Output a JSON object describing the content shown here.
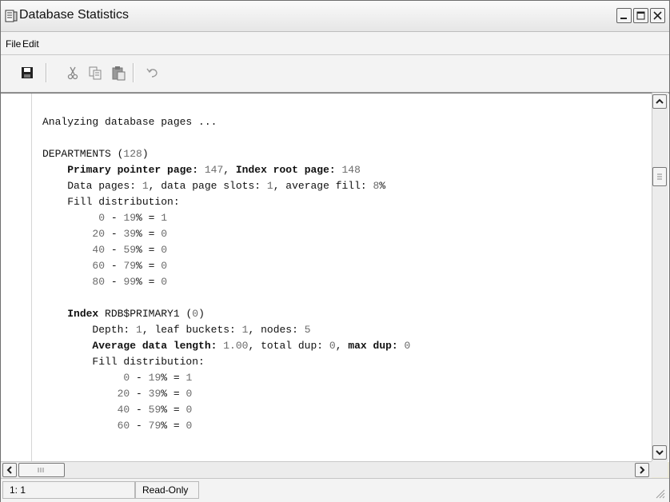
{
  "window": {
    "title": "Database Statistics",
    "app_icon": "database-statistics-icon"
  },
  "menu": [
    "File",
    "Edit"
  ],
  "toolbar": {
    "buttons": [
      "save-icon",
      "cut-icon",
      "copy-icon",
      "paste-icon",
      "undo-icon"
    ]
  },
  "editor": {
    "lines": [
      {
        "segments": [
          {
            "text": "Analyzing database pages ..."
          }
        ]
      },
      {
        "segments": []
      },
      {
        "segments": [
          {
            "text": "DEPARTMENTS ("
          },
          {
            "text": "128",
            "num": true
          },
          {
            "text": ")"
          }
        ]
      },
      {
        "segments": [
          {
            "text": "    "
          },
          {
            "text": "Primary pointer page: ",
            "bold": true
          },
          {
            "text": "147",
            "num": true
          },
          {
            "text": ", "
          },
          {
            "text": "Index root page: ",
            "bold": true
          },
          {
            "text": "148",
            "num": true
          }
        ]
      },
      {
        "segments": [
          {
            "text": "    Data pages: "
          },
          {
            "text": "1",
            "num": true
          },
          {
            "text": ", data page slots: "
          },
          {
            "text": "1",
            "num": true
          },
          {
            "text": ", average fill: "
          },
          {
            "text": "8",
            "num": true
          },
          {
            "text": "%"
          }
        ]
      },
      {
        "segments": [
          {
            "text": "    Fill distribution:"
          }
        ]
      },
      {
        "segments": [
          {
            "text": "         "
          },
          {
            "text": "0",
            "num": true
          },
          {
            "text": " - "
          },
          {
            "text": "19",
            "num": true
          },
          {
            "text": "% = "
          },
          {
            "text": "1",
            "num": true
          }
        ]
      },
      {
        "segments": [
          {
            "text": "        "
          },
          {
            "text": "20",
            "num": true
          },
          {
            "text": " - "
          },
          {
            "text": "39",
            "num": true
          },
          {
            "text": "% = "
          },
          {
            "text": "0",
            "num": true
          }
        ]
      },
      {
        "segments": [
          {
            "text": "        "
          },
          {
            "text": "40",
            "num": true
          },
          {
            "text": " - "
          },
          {
            "text": "59",
            "num": true
          },
          {
            "text": "% = "
          },
          {
            "text": "0",
            "num": true
          }
        ]
      },
      {
        "segments": [
          {
            "text": "        "
          },
          {
            "text": "60",
            "num": true
          },
          {
            "text": " - "
          },
          {
            "text": "79",
            "num": true
          },
          {
            "text": "% = "
          },
          {
            "text": "0",
            "num": true
          }
        ]
      },
      {
        "segments": [
          {
            "text": "        "
          },
          {
            "text": "80",
            "num": true
          },
          {
            "text": " - "
          },
          {
            "text": "99",
            "num": true
          },
          {
            "text": "% = "
          },
          {
            "text": "0",
            "num": true
          }
        ]
      },
      {
        "segments": []
      },
      {
        "segments": [
          {
            "text": "    "
          },
          {
            "text": "Index ",
            "bold": true
          },
          {
            "text": "RDB$PRIMARY1 ("
          },
          {
            "text": "0",
            "num": true
          },
          {
            "text": ")"
          }
        ]
      },
      {
        "segments": [
          {
            "text": "        Depth: "
          },
          {
            "text": "1",
            "num": true
          },
          {
            "text": ", leaf buckets: "
          },
          {
            "text": "1",
            "num": true
          },
          {
            "text": ", nodes: "
          },
          {
            "text": "5",
            "num": true
          }
        ]
      },
      {
        "segments": [
          {
            "text": "        "
          },
          {
            "text": "Average data length: ",
            "bold": true
          },
          {
            "text": "1.00",
            "num": true
          },
          {
            "text": ", total dup: "
          },
          {
            "text": "0",
            "num": true
          },
          {
            "text": ", "
          },
          {
            "text": "max dup: ",
            "bold": true
          },
          {
            "text": "0",
            "num": true
          }
        ]
      },
      {
        "segments": [
          {
            "text": "        Fill distribution:"
          }
        ]
      },
      {
        "segments": [
          {
            "text": "             "
          },
          {
            "text": "0",
            "num": true
          },
          {
            "text": " - "
          },
          {
            "text": "19",
            "num": true
          },
          {
            "text": "% = "
          },
          {
            "text": "1",
            "num": true
          }
        ]
      },
      {
        "segments": [
          {
            "text": "            "
          },
          {
            "text": "20",
            "num": true
          },
          {
            "text": " - "
          },
          {
            "text": "39",
            "num": true
          },
          {
            "text": "% = "
          },
          {
            "text": "0",
            "num": true
          }
        ]
      },
      {
        "segments": [
          {
            "text": "            "
          },
          {
            "text": "40",
            "num": true
          },
          {
            "text": " - "
          },
          {
            "text": "59",
            "num": true
          },
          {
            "text": "% = "
          },
          {
            "text": "0",
            "num": true
          }
        ]
      },
      {
        "segments": [
          {
            "text": "            "
          },
          {
            "text": "60",
            "num": true
          },
          {
            "text": " - "
          },
          {
            "text": "79",
            "num": true
          },
          {
            "text": "% = "
          },
          {
            "text": "0",
            "num": true
          }
        ]
      }
    ]
  },
  "status": {
    "position": "1: 1",
    "mode": "Read-Only"
  },
  "colors": {
    "numbers": "#6a6a6a",
    "text": "#111111",
    "chrome": "#f3f3f3"
  }
}
